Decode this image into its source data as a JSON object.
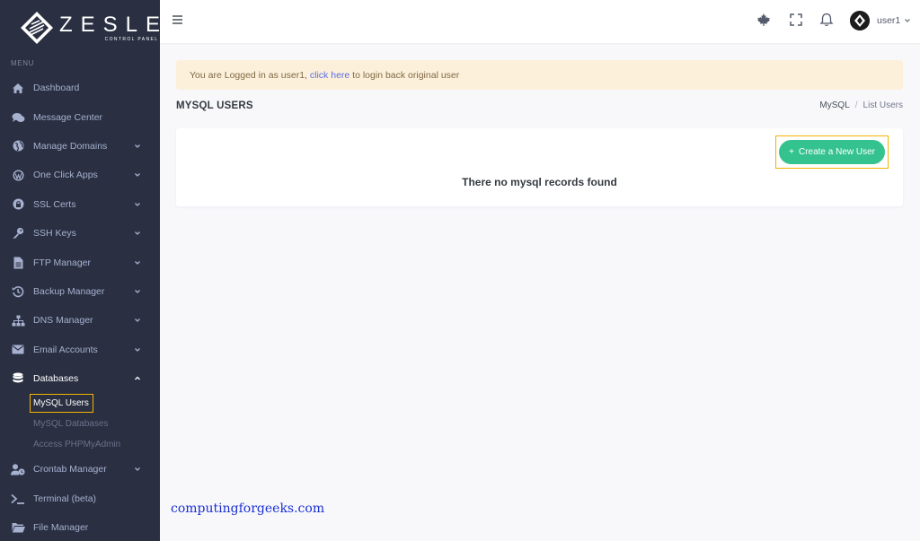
{
  "logo": {
    "word": "ZESLE",
    "subtitle": "CONTROL PANEL"
  },
  "sidebar": {
    "menu_title": "MENU",
    "items": [
      {
        "label": "Dashboard",
        "icon": "home-icon"
      },
      {
        "label": "Message Center",
        "icon": "chat-icon"
      },
      {
        "label": "Manage Domains",
        "icon": "globe-icon"
      },
      {
        "label": "One Click Apps",
        "icon": "wordpress-icon"
      },
      {
        "label": "SSL Certs",
        "icon": "lock-icon"
      },
      {
        "label": "SSH Keys",
        "icon": "key-icon"
      },
      {
        "label": "FTP Manager",
        "icon": "file-icon"
      },
      {
        "label": "Backup Manager",
        "icon": "history-icon"
      },
      {
        "label": "DNS Manager",
        "icon": "sitemap-icon"
      },
      {
        "label": "Email Accounts",
        "icon": "envelope-icon"
      },
      {
        "label": "Databases",
        "icon": "database-icon"
      },
      {
        "label": "Crontab Manager",
        "icon": "user-clock-icon"
      },
      {
        "label": "Terminal (beta)",
        "icon": "terminal-icon"
      },
      {
        "label": "File Manager",
        "icon": "folder-icon"
      }
    ],
    "sub_items": [
      {
        "label": "MySQL Users"
      },
      {
        "label": "MySQL Databases"
      },
      {
        "label": "Access PHPMyAdmin"
      }
    ]
  },
  "topbar": {
    "username": "user1"
  },
  "alert": {
    "prefix": "You are Logged in as user1, ",
    "link": "click here",
    "suffix": " to login back original user"
  },
  "page": {
    "title": "MYSQL USERS",
    "breadcrumb": [
      "MySQL",
      "List Users"
    ]
  },
  "card": {
    "button_label": "Create a New User",
    "button_icon": "+",
    "empty_message": "There no mysql records found"
  },
  "watermark": "computingforgeeks.com",
  "colors": {
    "sidebar_bg": "#2a3042",
    "accent_green": "#34c38f",
    "highlight": "#f5b400",
    "alert_bg": "#fcf0db"
  }
}
